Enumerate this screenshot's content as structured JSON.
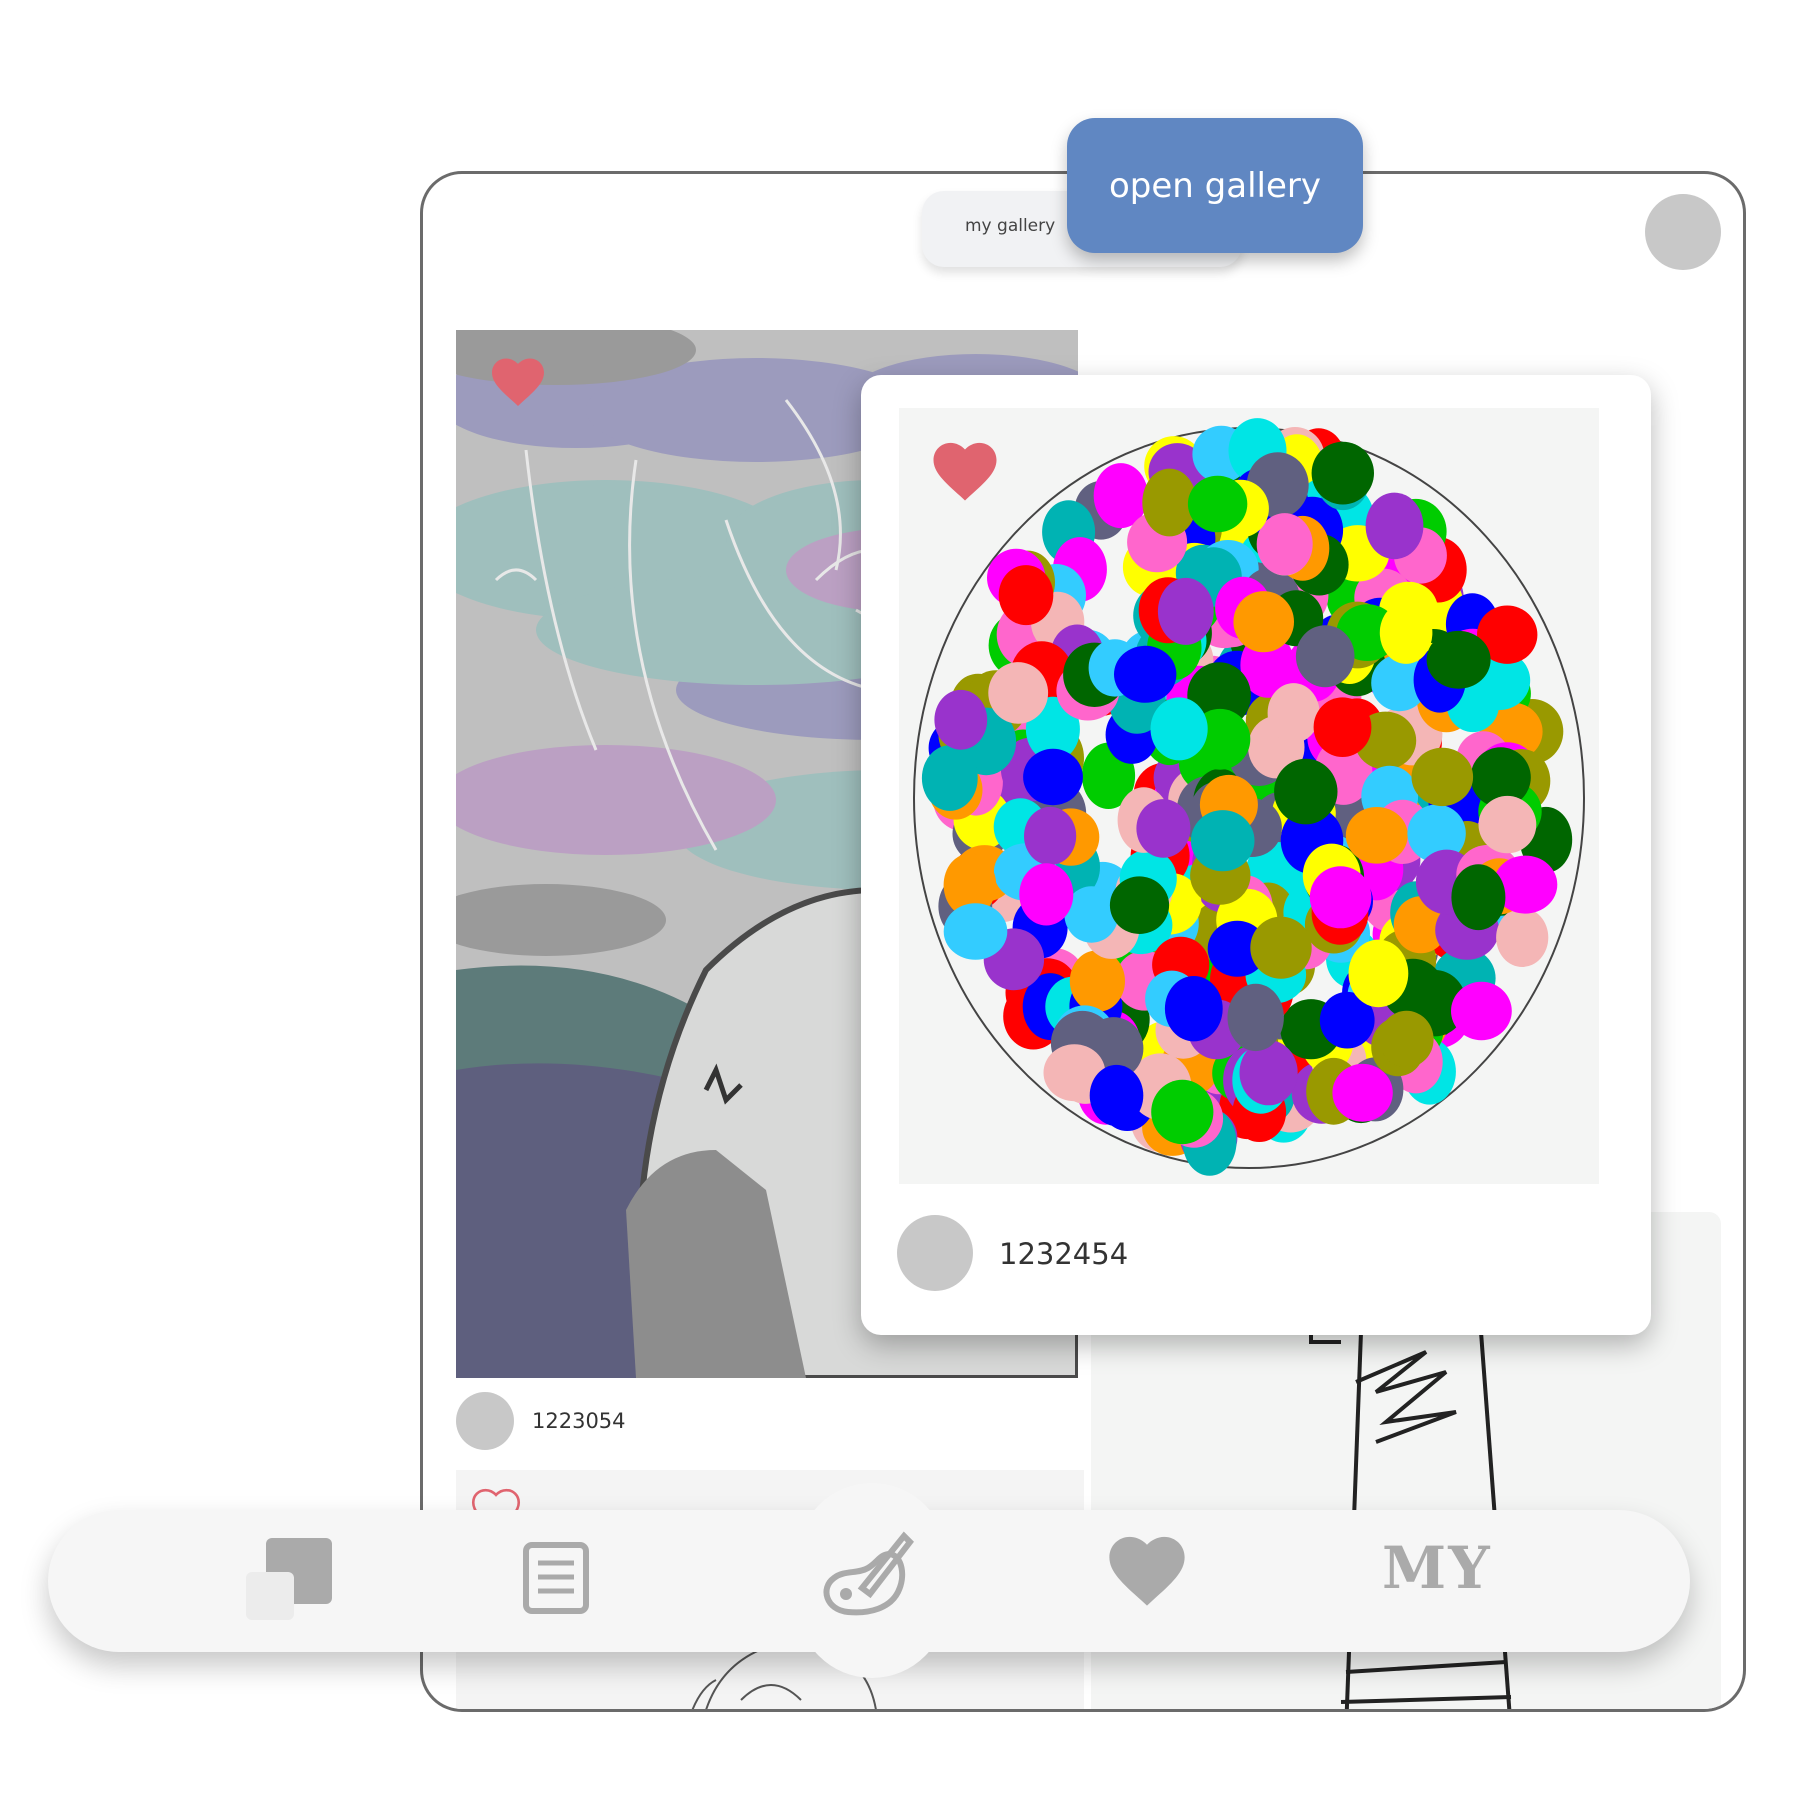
{
  "header": {
    "toggle_label": "my gallery",
    "open_button_label": "open gallery"
  },
  "feed": {
    "left_post": {
      "user_id": "1223054",
      "liked": true
    },
    "popup_post": {
      "user_id": "1232454",
      "liked": true
    }
  },
  "nav": {
    "items": [
      {
        "name": "collections-icon"
      },
      {
        "name": "list-icon"
      },
      {
        "name": "draw-icon"
      },
      {
        "name": "heart-icon"
      },
      {
        "label": "MY"
      }
    ]
  },
  "colors": {
    "accent": "#6087c2",
    "like": "#e0646f",
    "icon": "#aaaaaa"
  }
}
